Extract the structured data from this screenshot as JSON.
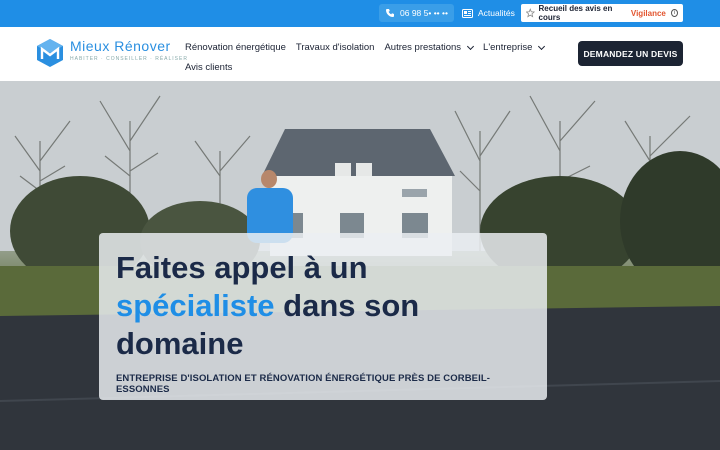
{
  "topbar": {
    "phone": "06 98 5• •• ••",
    "news_label": "Actualités",
    "reviews_label": "Recueil des avis en cours",
    "reviews_brand": "Vigilance",
    "reviews_info": "i"
  },
  "header": {
    "logo_name": "Mieux Rénover",
    "logo_tagline": "HABITER · CONSEILLER · RÉALISER",
    "nav": [
      {
        "label": "Rénovation énergétique"
      },
      {
        "label": "Travaux d'isolation"
      },
      {
        "label": "Autres prestations"
      },
      {
        "label": "L'entreprise"
      },
      {
        "label": "Avis clients"
      }
    ],
    "cta_label": "DEMANDEZ UN DEVIS"
  },
  "hero": {
    "title_line1": "Faites appel à un",
    "title_accent": "spécialiste",
    "title_line2_rest": " dans son",
    "title_line3": "domaine",
    "subtitle": "ENTREPRISE D'ISOLATION ET RÉNOVATION ÉNERGÉTIQUE PRÈS DE CORBEIL-ESSONNES"
  },
  "colors": {
    "brand_blue": "#1f8ee6",
    "navy": "#1b2a48",
    "cta_bg": "#1c2433",
    "vigilance": "#e2552f"
  }
}
